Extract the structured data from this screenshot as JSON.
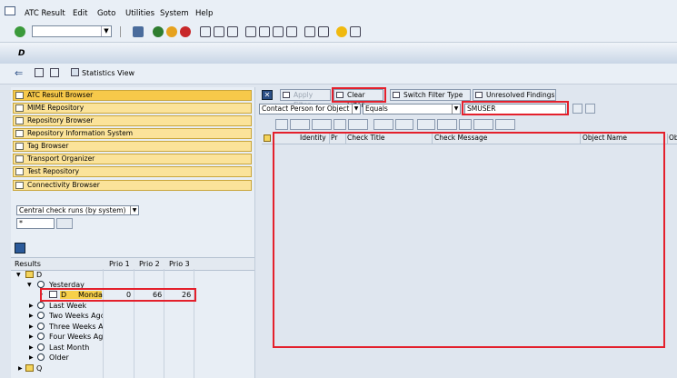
{
  "menu": [
    "ATC Result",
    "Edit",
    "Goto",
    "Utilities",
    "System",
    "Help"
  ],
  "title": "D",
  "app_toolbar": {
    "stats_label": "Statistics View"
  },
  "nav": [
    "ATC Result Browser",
    "MIME Repository",
    "Repository Browser",
    "Repository Information System",
    "Tag Browser",
    "Transport Organizer",
    "Test Repository",
    "Connectivity Browser"
  ],
  "variant": {
    "value": "Central check runs (by system)"
  },
  "filter": {
    "value": "*"
  },
  "results": {
    "header": {
      "results": "Results",
      "p1": "Prio 1",
      "p2": "Prio 2",
      "p3": "Prio 3"
    },
    "root1": "D",
    "yesterday": "Yesterday",
    "item": {
      "system": "D",
      "day": "Monda",
      "p1": "0",
      "p2": "66",
      "p3": "26"
    },
    "periods": [
      "Last Week",
      "Two Weeks Ago",
      "Three Weeks Ago",
      "Four Weeks Ago",
      "Last Month",
      "Older"
    ],
    "root2": "Q"
  },
  "filterbar": {
    "apply": "Apply Filter",
    "clear": "Clear Filter",
    "switch": "Switch Filter Type",
    "unresolved": "Unresolved Findings",
    "field": "Contact Person for Object",
    "operator": "Equals",
    "value": "SMUSER"
  },
  "grid": {
    "columns": [
      "Identity",
      "Pr",
      "Check Title",
      "Check Message",
      "Object Name",
      "Ob"
    ]
  },
  "colors": {
    "highlight": "#e4202c",
    "nav_button": "#fbe39a"
  }
}
